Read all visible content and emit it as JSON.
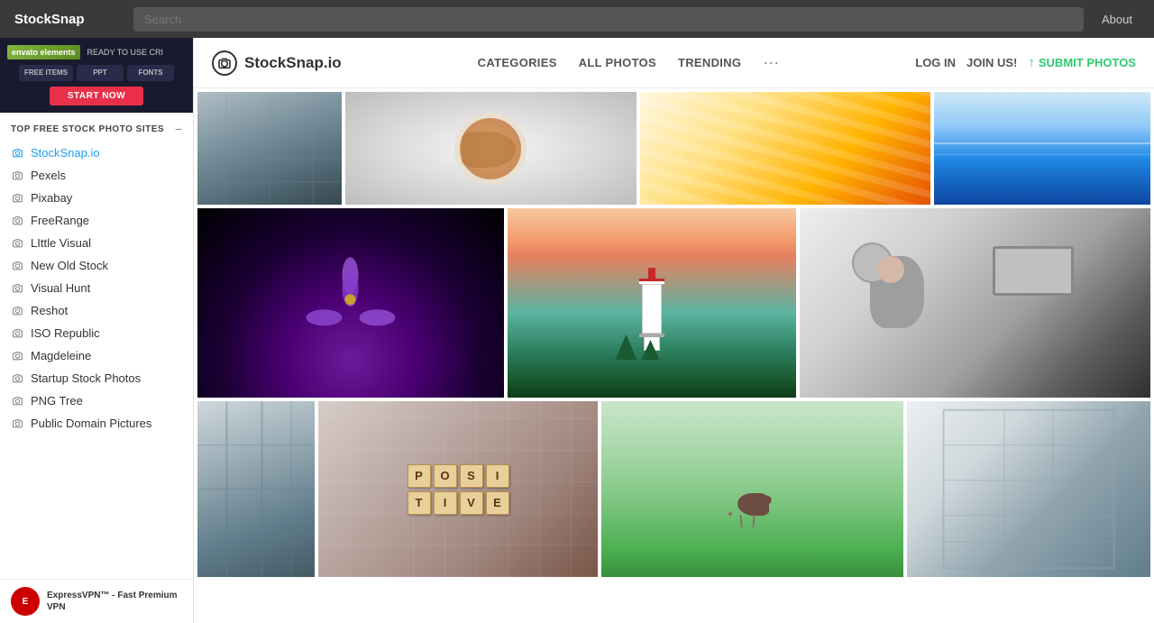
{
  "browser": {
    "title": "StockSnap",
    "search_placeholder": "Search",
    "about_label": "About"
  },
  "ad": {
    "logo": "envato elements",
    "tagline": "READY TO USE CRI",
    "items": [
      {
        "label": "FREE ITEMS",
        "sub": ""
      },
      {
        "label": "PPT",
        "sub": ""
      },
      {
        "label": "FONTS",
        "sub": ""
      }
    ],
    "cta": "START NOW"
  },
  "sidebar": {
    "section_title": "TOP FREE STOCK PHOTO SITES",
    "collapse_icon": "−",
    "items": [
      {
        "label": "StockSnap.io",
        "active": true
      },
      {
        "label": "Pexels",
        "active": false
      },
      {
        "label": "Pixabay",
        "active": false
      },
      {
        "label": "FreeRange",
        "active": false
      },
      {
        "label": "LIttle Visual",
        "active": false
      },
      {
        "label": "New Old Stock",
        "active": false
      },
      {
        "label": "Visual Hunt",
        "active": false
      },
      {
        "label": "Reshot",
        "active": false
      },
      {
        "label": "ISO Republic",
        "active": false
      },
      {
        "label": "Magdeleine",
        "active": false
      },
      {
        "label": "Startup Stock Photos",
        "active": false
      },
      {
        "label": "PNG Tree",
        "active": false
      },
      {
        "label": "Public Domain Pictures",
        "active": false
      }
    ],
    "bottom_ad": {
      "icon_text": "E",
      "title": "ExpressVPN™ - Fast Premium VPN"
    }
  },
  "header": {
    "logo_text": "StockSnap.io",
    "nav": [
      {
        "label": "CATEGORIES"
      },
      {
        "label": "ALL PHOTOS"
      },
      {
        "label": "TRENDING"
      },
      {
        "label": "···"
      }
    ],
    "login": "LOG IN",
    "join": "JOIN US!",
    "submit": "SUBMIT PHOTOS",
    "submit_icon": "↑"
  },
  "photos": {
    "row1": [
      {
        "id": "building1",
        "class": "photo-building1",
        "alt": "Building exterior"
      },
      {
        "id": "food",
        "class": "photo-food",
        "alt": "Food dish"
      },
      {
        "id": "pencils",
        "class": "photo-pencils",
        "alt": "Pencils close up"
      },
      {
        "id": "ocean",
        "class": "photo-ocean",
        "alt": "Ocean view"
      }
    ],
    "row2": [
      {
        "id": "flower",
        "class": "photo-flower",
        "alt": "Purple flower close up"
      },
      {
        "id": "lighthouse",
        "class": "photo-lighthouse",
        "alt": "Lighthouse by the sea"
      },
      {
        "id": "man-laptop",
        "class": "photo-man-laptop",
        "alt": "Man with laptop"
      }
    ],
    "row3": [
      {
        "id": "building2",
        "class": "photo-building2",
        "alt": "Building architecture"
      },
      {
        "id": "scrabble",
        "class": "photo-scrabble",
        "alt": "Scrabble tiles spelling POSITIVE"
      },
      {
        "id": "bird",
        "class": "photo-bird",
        "alt": "Bird in grass"
      },
      {
        "id": "building3",
        "class": "photo-building3",
        "alt": "Modern building"
      }
    ]
  },
  "scrabble_word": [
    "P",
    "O",
    "S",
    "I",
    "T",
    "I",
    "V",
    "E"
  ]
}
